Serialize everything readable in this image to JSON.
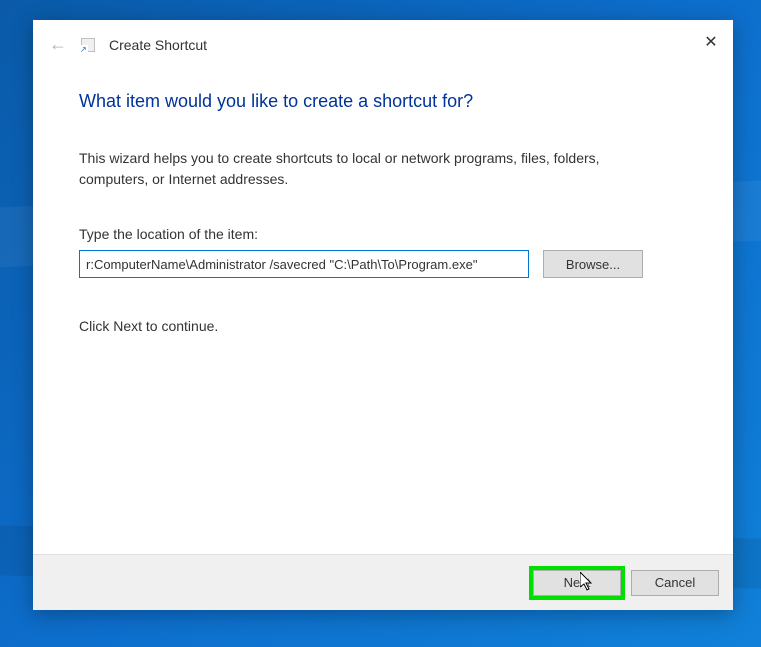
{
  "dialog": {
    "title": "Create Shortcut",
    "close_icon": "✕",
    "back_icon": "←"
  },
  "content": {
    "heading": "What item would you like to create a shortcut for?",
    "description": "This wizard helps you to create shortcuts to local or network programs, files, folders, computers, or Internet addresses.",
    "location_label": "Type the location of the item:",
    "location_value": "r:ComputerName\\Administrator /savecred \"C:\\Path\\To\\Program.exe\"",
    "browse_label": "Browse...",
    "continue_text": "Click Next to continue."
  },
  "footer": {
    "next_label": "Next",
    "cancel_label": "Cancel"
  }
}
